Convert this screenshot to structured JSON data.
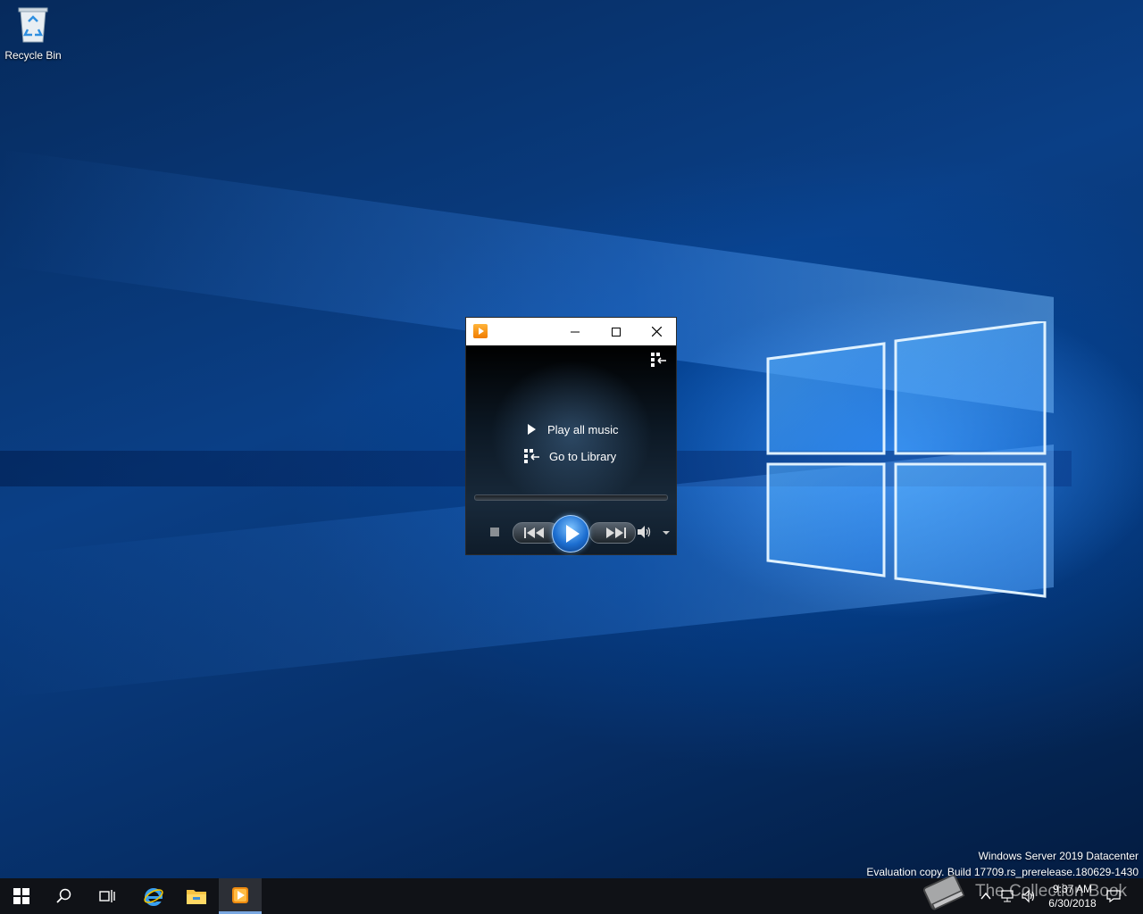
{
  "desktop": {
    "icons": [
      {
        "label": "Recycle Bin",
        "icon": "recycle-bin-icon"
      }
    ],
    "watermark": {
      "line1": "Windows Server 2019 Datacenter",
      "line2": "Evaluation copy. Build 17709.rs_prerelease.180629-1430"
    },
    "overlay_watermark": "The Collection Book"
  },
  "player": {
    "icon": "windows-media-player-icon",
    "actions": {
      "play_all": "Play all music",
      "go_library": "Go to Library"
    },
    "progress": 0
  },
  "taskbar": {
    "items": [
      "start-icon",
      "search-icon",
      "task-view-icon",
      "internet-explorer-icon",
      "file-explorer-icon",
      "windows-media-player-icon"
    ],
    "active_item": "windows-media-player-icon",
    "clock": {
      "time": "9:37 AM",
      "date": "6/30/2018"
    }
  },
  "colors": {
    "accent": "#7aa7e0",
    "taskbar": "#101217",
    "play_button": "#1d6fd1"
  }
}
